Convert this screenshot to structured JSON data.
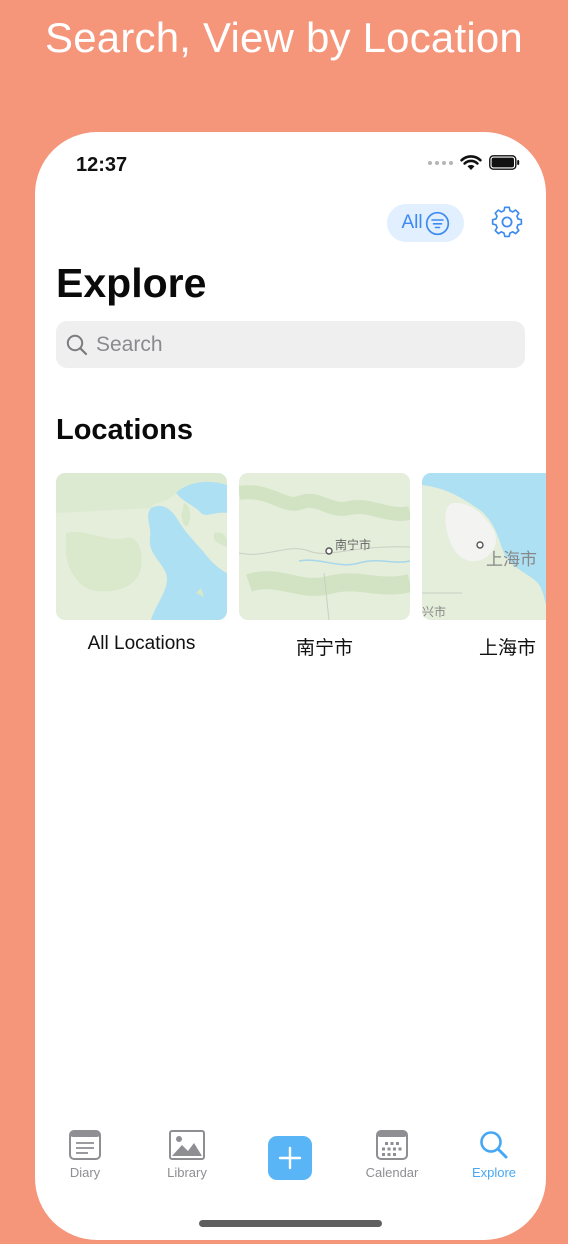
{
  "promo": {
    "title": "Search, View by Location"
  },
  "status_bar": {
    "time": "12:37"
  },
  "header": {
    "filter_label": "All",
    "title": "Explore"
  },
  "search": {
    "placeholder": "Search",
    "value": ""
  },
  "locations": {
    "section_title": "Locations",
    "items": [
      {
        "label": "All Locations",
        "map_label": ""
      },
      {
        "label": "南宁市",
        "map_label": "南宁市"
      },
      {
        "label": "上海市",
        "map_label": "上海市",
        "map_label_2": "兴市"
      }
    ]
  },
  "tab_bar": {
    "tabs": [
      {
        "label": "Diary",
        "icon": "diary-icon"
      },
      {
        "label": "Library",
        "icon": "photo-library-icon"
      },
      {
        "label": "",
        "icon": "plus-icon"
      },
      {
        "label": "Calendar",
        "icon": "calendar-icon"
      },
      {
        "label": "Explore",
        "icon": "search-icon"
      }
    ],
    "active": "Explore"
  },
  "colors": {
    "background": "#f5957a",
    "accent": "#46a8f5",
    "pill_bg": "#e1efff",
    "map_land": "#e4eedb",
    "map_water": "#aee0f3"
  }
}
